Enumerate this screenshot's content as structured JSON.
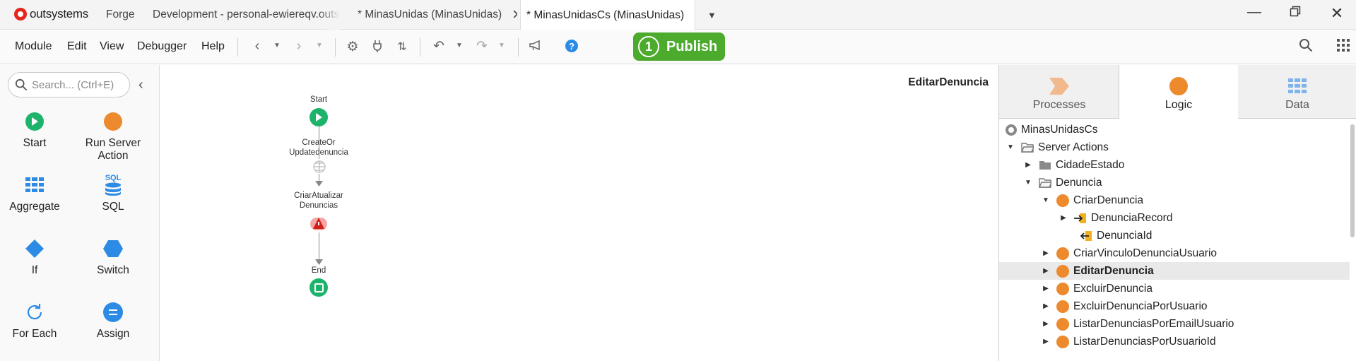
{
  "app": {
    "logo_text": "outsystems"
  },
  "tabs": [
    {
      "label": "Forge"
    },
    {
      "label": "Development - personal-ewiereqv.outsy"
    },
    {
      "label": "* MinasUnidas (MinasUnidas)"
    },
    {
      "label": "* MinasUnidasCs (MinasUnidas)"
    }
  ],
  "menu": {
    "module": "Module",
    "edit": "Edit",
    "view": "View",
    "debugger": "Debugger",
    "help": "Help"
  },
  "toolbar": {
    "publish_count": "1",
    "publish_label": "Publish",
    "help_glyph": "?"
  },
  "search": {
    "placeholder": "Search... (Ctrl+E)"
  },
  "tools": [
    {
      "label": "Start",
      "icon": "start-icon"
    },
    {
      "label": "Run Server Action",
      "icon": "run-server-action-icon"
    },
    {
      "label": "Aggregate",
      "icon": "aggregate-icon"
    },
    {
      "label": "SQL",
      "icon": "sql-icon"
    },
    {
      "label": "If",
      "icon": "if-icon"
    },
    {
      "label": "Switch",
      "icon": "switch-icon"
    },
    {
      "label": "For Each",
      "icon": "for-each-icon"
    },
    {
      "label": "Assign",
      "icon": "assign-icon"
    }
  ],
  "sql_icon_text": "SQL",
  "canvas": {
    "title": "EditarDenuncia",
    "nodes": {
      "start": "Start",
      "create_line1": "CreateOr",
      "create_line2": "Updatedenuncia",
      "criar_line1": "CriarAtualizar",
      "criar_line2": "Denuncias",
      "end": "End"
    }
  },
  "right_tabs": [
    {
      "label": "Processes"
    },
    {
      "label": "Logic"
    },
    {
      "label": "Data"
    }
  ],
  "tree": [
    {
      "label": "MinasUnidasCs",
      "level": 0,
      "type": "module"
    },
    {
      "label": "Server Actions",
      "level": 0,
      "type": "folder-open",
      "expanded": true
    },
    {
      "label": "CidadeEstado",
      "level": 1,
      "type": "folder",
      "expanded": false
    },
    {
      "label": "Denuncia",
      "level": 1,
      "type": "folder-open",
      "expanded": true
    },
    {
      "label": "CriarDenuncia",
      "level": 2,
      "type": "action",
      "expanded": true
    },
    {
      "label": "DenunciaRecord",
      "level": 3,
      "type": "input-param",
      "expanded": false
    },
    {
      "label": "DenunciaId",
      "level": 3,
      "type": "output-param"
    },
    {
      "label": "CriarVinculoDenunciaUsuario",
      "level": 2,
      "type": "action",
      "expanded": false
    },
    {
      "label": "EditarDenuncia",
      "level": 2,
      "type": "action",
      "expanded": false,
      "selected": true
    },
    {
      "label": "ExcluirDenuncia",
      "level": 2,
      "type": "action",
      "expanded": false
    },
    {
      "label": "ExcluirDenunciaPorUsuario",
      "level": 2,
      "type": "action",
      "expanded": false
    },
    {
      "label": "ListarDenunciasPorEmailUsuario",
      "level": 2,
      "type": "action",
      "expanded": false
    },
    {
      "label": "ListarDenunciasPorUsuarioId",
      "level": 2,
      "type": "action",
      "expanded": false
    }
  ],
  "colors": {
    "publish": "#4caa2d",
    "start_node": "#1db36b",
    "action": "#ee8a2e",
    "logo": "#e5261b",
    "icon_blue": "#2d8be6"
  }
}
